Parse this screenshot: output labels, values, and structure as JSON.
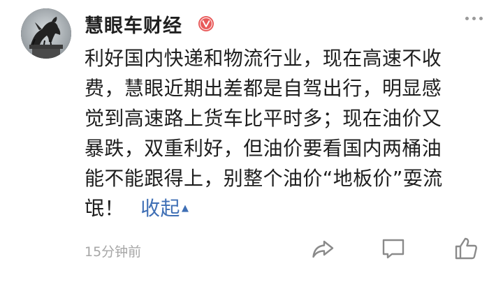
{
  "post": {
    "author": "慧眼车财经",
    "badge_icon": "verified-v-badge-icon",
    "content_lines": [
      "利好国内快递和物流行业，现在高速不收",
      "费，慧眼近期出差都是自驾出行，明显感",
      "觉到高速路上货车比平时多；现在油价又",
      "暴跌，双重利好，但油价要看国内两桶油",
      "能不能跟得上，别整个油价“地板价”耍流",
      "氓！"
    ],
    "collapse_label": "收起",
    "collapse_arrow": "▲",
    "timestamp": "15分钟前"
  },
  "actions": {
    "share": "share-icon",
    "comment": "comment-icon",
    "like": "thumbs-up-icon",
    "more": "more-dots-icon"
  },
  "colors": {
    "link": "#3f6fb5",
    "badge": "#e85a5a",
    "muted": "#a6a6a6"
  }
}
